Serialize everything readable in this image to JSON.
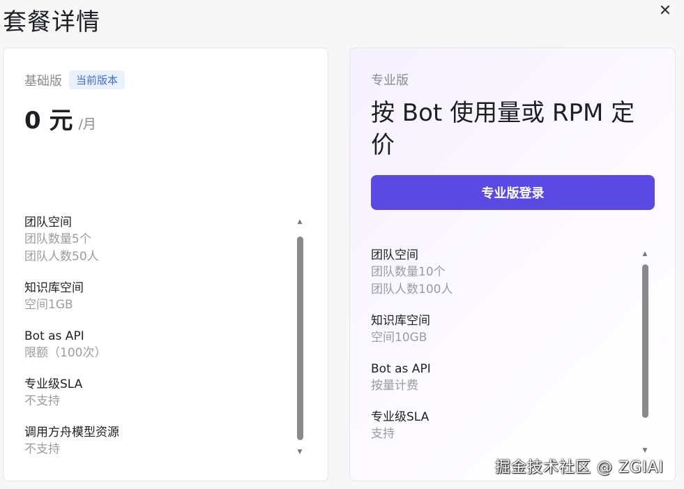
{
  "dialog": {
    "title": "套餐详情",
    "close_icon": "close-icon"
  },
  "basic": {
    "tier": "基础版",
    "badge": "当前版本",
    "price_amount": "0 元",
    "price_unit": "/月",
    "features": [
      {
        "title": "团队空间",
        "lines": [
          "团队数量5个",
          "团队人数50人"
        ]
      },
      {
        "title": "知识库空间",
        "lines": [
          "空间1GB"
        ]
      },
      {
        "title": "Bot as API",
        "lines": [
          "限额（100次）"
        ]
      },
      {
        "title": "专业级SLA",
        "lines": [
          "不支持"
        ]
      },
      {
        "title": "调用方舟模型资源",
        "lines": [
          "不支持"
        ]
      }
    ]
  },
  "pro": {
    "tier": "专业版",
    "headline": "按 Bot 使用量或 RPM 定价",
    "login_button": "专业版登录",
    "accent_color": "#5a4ae3",
    "features": [
      {
        "title": "团队空间",
        "lines": [
          "团队数量10个",
          "团队人数100人"
        ]
      },
      {
        "title": "知识库空间",
        "lines": [
          "空间10GB"
        ]
      },
      {
        "title": "Bot as API",
        "lines": [
          "按量计费"
        ]
      },
      {
        "title": "专业级SLA",
        "lines": [
          "支持"
        ]
      }
    ]
  },
  "watermark": "掘金技术社区 @ ZGIAI"
}
